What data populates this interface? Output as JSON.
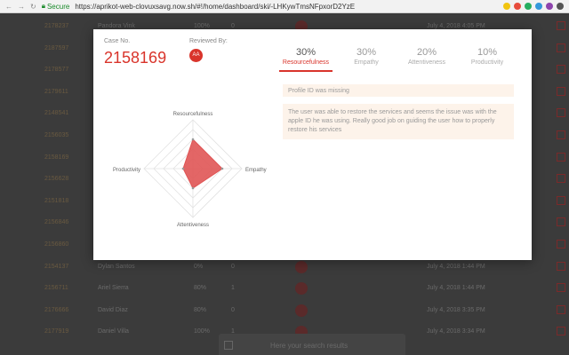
{
  "browser": {
    "secure_label": "Secure",
    "url": "https://aprikot-web-clovuxsavg.now.sh/#!/home/dashboard/ski/-LHKywTmsNFpxorD2YzE"
  },
  "background": {
    "rows": [
      {
        "id": "2178237",
        "name": "Pandora Vink",
        "v1": "100%",
        "v2": "0",
        "date": "July 4, 2018 4:05 PM"
      },
      {
        "id": "2187597",
        "name": "",
        "v1": "",
        "v2": "",
        "date": ""
      },
      {
        "id": "2178577",
        "name": "",
        "v1": "",
        "v2": "",
        "date": ""
      },
      {
        "id": "2179611",
        "name": "",
        "v1": "",
        "v2": "",
        "date": ""
      },
      {
        "id": "2148541",
        "name": "",
        "v1": "",
        "v2": "",
        "date": ""
      },
      {
        "id": "2156035",
        "name": "",
        "v1": "",
        "v2": "",
        "date": ""
      },
      {
        "id": "2158169",
        "name": "",
        "v1": "",
        "v2": "",
        "date": ""
      },
      {
        "id": "2156628",
        "name": "",
        "v1": "",
        "v2": "",
        "date": ""
      },
      {
        "id": "2151818",
        "name": "",
        "v1": "",
        "v2": "",
        "date": ""
      },
      {
        "id": "2156846",
        "name": "",
        "v1": "",
        "v2": "",
        "date": ""
      },
      {
        "id": "2156860",
        "name": "",
        "v1": "",
        "v2": "",
        "date": ""
      },
      {
        "id": "2154137",
        "name": "Dylan Santos",
        "v1": "0%",
        "v2": "0",
        "date": "July 4, 2018 1:44 PM"
      },
      {
        "id": "2156711",
        "name": "Ariel Sierra",
        "v1": "80%",
        "v2": "1",
        "date": "July 4, 2018 1:44 PM"
      },
      {
        "id": "2176666",
        "name": "David Diaz",
        "v1": "80%",
        "v2": "0",
        "date": "July 4, 2018 3:35 PM"
      },
      {
        "id": "2177919",
        "name": "Daniel Villa",
        "v1": "100%",
        "v2": "1",
        "date": "July 4, 2018 3:34 PM"
      }
    ],
    "bottom_text": "Here your search results"
  },
  "modal": {
    "case_label": "Case No.",
    "case_number": "2158169",
    "reviewed_label": "Reviewed By:",
    "reviewer_initials": "AA",
    "scores": [
      {
        "pct": "30%",
        "category": "Resourcefulness",
        "active": true
      },
      {
        "pct": "30%",
        "category": "Empathy",
        "active": false
      },
      {
        "pct": "20%",
        "category": "Attentiveness",
        "active": false
      },
      {
        "pct": "10%",
        "category": "Productivity",
        "active": false
      }
    ],
    "notes": [
      "Profile ID was missing",
      "The user was able to restore the services and seems the issue was with the apple ID he was using. Really good job on guiding the user how to properly restore his services"
    ]
  },
  "chart_data": {
    "type": "radar",
    "axes": [
      "Resourcefulness",
      "Empathy",
      "Attentiveness",
      "Productivity"
    ],
    "values": [
      0.3,
      0.3,
      0.2,
      0.1
    ],
    "range": [
      0,
      0.5
    ],
    "rings": 5,
    "color": "#e05555"
  }
}
